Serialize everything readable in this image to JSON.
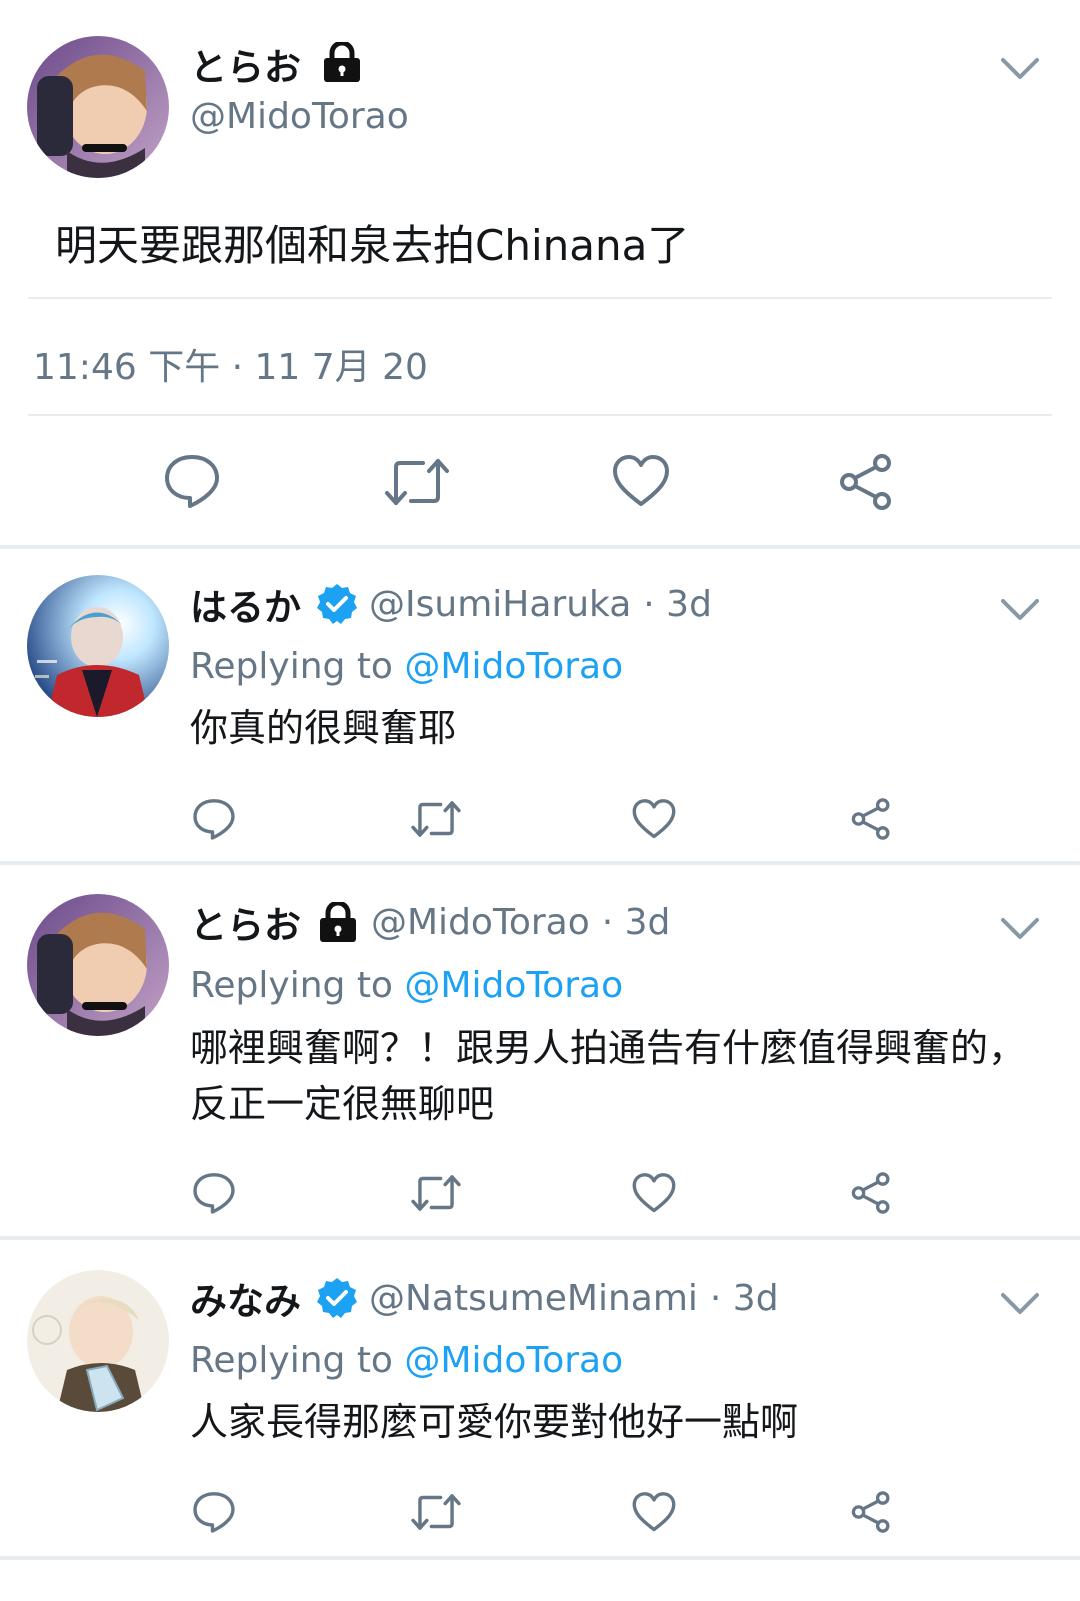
{
  "main_tweet": {
    "display_name": "とらお",
    "handle": "@MidoTorao",
    "text": "明天要跟那個和泉去拍Chinana了",
    "timestamp": "11:46 下午 · 11 7月 20",
    "locked": true
  },
  "replies": [
    {
      "display_name": "はるか",
      "verified": true,
      "handle": "@IsumiHaruka",
      "age": "· 3d",
      "replying_label": "Replying to",
      "replying_handle": "@MidoTorao",
      "text": "你真的很興奮耶"
    },
    {
      "display_name": "とらお",
      "locked": true,
      "handle": "@MidoTorao",
      "age": "· 3d",
      "replying_label": "Replying to",
      "replying_handle": "@MidoTorao",
      "text_line1": "哪裡興奮啊？！跟男人拍通告有什麼值得興奮的，",
      "text_line2": "反正一定很無聊吧"
    },
    {
      "display_name": "みなみ",
      "verified": true,
      "handle": "@NatsumeMinami",
      "age": "· 3d",
      "replying_label": "Replying to",
      "replying_handle": "@MidoTorao",
      "text": "人家長得那麼可愛你要對他好一點啊"
    }
  ],
  "colors": {
    "text": "#14171a",
    "secondary": "#657786",
    "accent": "#1da1f2",
    "divider": "#e6ecf0"
  },
  "icons": [
    "reply-icon",
    "retweet-icon",
    "like-icon",
    "share-icon",
    "chevron-down-icon",
    "lock-icon",
    "verified-badge-icon"
  ]
}
